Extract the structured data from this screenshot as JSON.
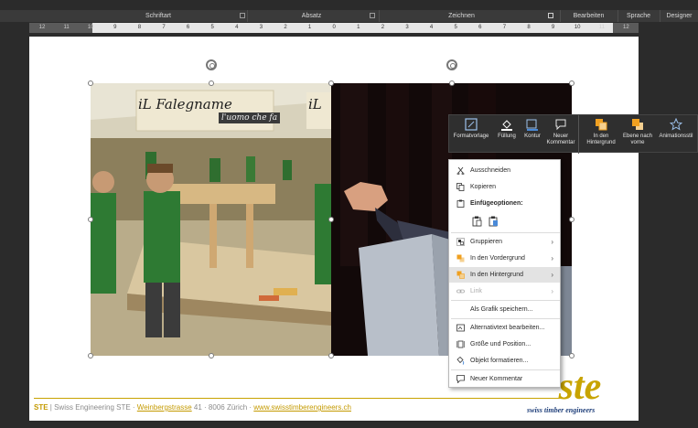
{
  "ribbon": {
    "groups": [
      "Schriftart",
      "Absatz",
      "Zeichnen",
      "Bearbeiten",
      "Sprache",
      "Designer"
    ]
  },
  "ruler": {
    "ticks": [
      "12",
      "11",
      "10",
      "9",
      "8",
      "7",
      "6",
      "5",
      "4",
      "3",
      "2",
      "1",
      "0",
      "1",
      "2",
      "3",
      "4",
      "5",
      "6",
      "7",
      "8",
      "9",
      "10",
      "11",
      "12"
    ]
  },
  "slide": {
    "banner_left": "iL Falegname",
    "banner_left_2": "l'uomo che fa",
    "banner_left_3": "iL",
    "footer": {
      "brand": "STE",
      "company": " | Swiss Engineering STE · ",
      "street": "Weinbergstrasse",
      "address": " 41 · 8006 Zürich · ",
      "website": "www.swisstimberengineers.ch"
    },
    "logo": {
      "mark": "ste",
      "subtitle": "swiss timber engineers"
    }
  },
  "mini_toolbar": {
    "items": [
      {
        "label": "Formatvorlage",
        "icon": "style-icon"
      },
      {
        "label": "Füllung",
        "icon": "fill-bucket-icon"
      },
      {
        "label": "Kontur",
        "icon": "outline-pen-icon"
      },
      {
        "label": "Neuer Kommentar",
        "icon": "comment-icon"
      },
      {
        "label": "In den Hintergrund",
        "icon": "send-backward-icon"
      },
      {
        "label": "Ebene nach vorne",
        "icon": "bring-forward-icon"
      },
      {
        "label": "Animationsstil",
        "icon": "animation-star-icon"
      }
    ],
    "accent": "#f0a020"
  },
  "context_menu": {
    "cut": "Ausschneiden",
    "copy": "Kopieren",
    "paste_options": "Einfügeoptionen:",
    "group": "Gruppieren",
    "bring_front": "In den Vordergrund",
    "send_back": "In den Hintergrund",
    "link": "Link",
    "save_as_image": "Als Grafik speichern...",
    "alt_text": "Alternativtext bearbeiten...",
    "size_position": "Größe und Position...",
    "format_object": "Objekt formatieren...",
    "new_comment": "Neuer Kommentar"
  }
}
